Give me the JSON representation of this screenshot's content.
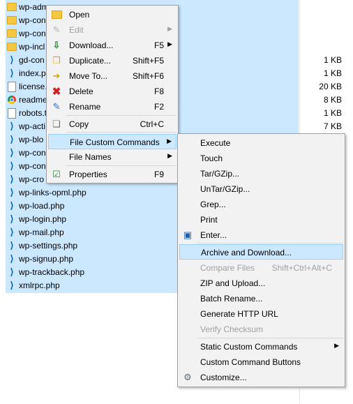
{
  "files": [
    {
      "name": "wp-adm",
      "icon": "folder-icon",
      "size": ""
    },
    {
      "name": "wp-con",
      "icon": "folder-icon",
      "size": ""
    },
    {
      "name": "wp-con",
      "icon": "folder-icon",
      "size": ""
    },
    {
      "name": "wp-incl",
      "icon": "folder-icon",
      "size": ""
    },
    {
      "name": "gd-con",
      "icon": "vscode-file-icon",
      "size": "1 KB"
    },
    {
      "name": "index.p",
      "icon": "vscode-file-icon",
      "size": "1 KB"
    },
    {
      "name": "license.",
      "icon": "text-file-icon",
      "size": "20 KB"
    },
    {
      "name": "readme",
      "icon": "chrome-file-icon",
      "size": "8 KB"
    },
    {
      "name": "robots.t",
      "icon": "text-file-icon",
      "size": "1 KB"
    },
    {
      "name": "wp-acti",
      "icon": "vscode-file-icon",
      "size": "7 KB"
    },
    {
      "name": "wp-blo",
      "icon": "vscode-file-icon",
      "size": ""
    },
    {
      "name": "wp-con",
      "icon": "vscode-file-icon",
      "size": ""
    },
    {
      "name": "wp-con",
      "icon": "vscode-file-icon",
      "size": ""
    },
    {
      "name": "wp-cro",
      "icon": "vscode-file-icon",
      "size": ""
    },
    {
      "name": "wp-links-opml.php",
      "icon": "vscode-file-icon",
      "size": ""
    },
    {
      "name": "wp-load.php",
      "icon": "vscode-file-icon",
      "size": ""
    },
    {
      "name": "wp-login.php",
      "icon": "vscode-file-icon",
      "size": ""
    },
    {
      "name": "wp-mail.php",
      "icon": "vscode-file-icon",
      "size": ""
    },
    {
      "name": "wp-settings.php",
      "icon": "vscode-file-icon",
      "size": ""
    },
    {
      "name": "wp-signup.php",
      "icon": "vscode-file-icon",
      "size": ""
    },
    {
      "name": "wp-trackback.php",
      "icon": "vscode-file-icon",
      "size": ""
    },
    {
      "name": "xmlrpc.php",
      "icon": "vscode-file-icon",
      "size": ""
    }
  ],
  "context_menu": {
    "items": [
      {
        "label": "Open",
        "shortcut": "",
        "icon": "open-folder-icon",
        "submenu": false,
        "disabled": false
      },
      {
        "label": "Edit",
        "shortcut": "",
        "icon": "edit-icon",
        "submenu": true,
        "disabled": true
      },
      {
        "label": "Download...",
        "shortcut": "F5",
        "icon": "download-icon",
        "submenu": true,
        "disabled": false
      },
      {
        "label": "Duplicate...",
        "shortcut": "Shift+F5",
        "icon": "duplicate-icon",
        "submenu": false,
        "disabled": false
      },
      {
        "label": "Move To...",
        "shortcut": "Shift+F6",
        "icon": "move-icon",
        "submenu": false,
        "disabled": false
      },
      {
        "label": "Delete",
        "shortcut": "F8",
        "icon": "delete-icon",
        "submenu": false,
        "disabled": false
      },
      {
        "label": "Rename",
        "shortcut": "F2",
        "icon": "rename-icon",
        "submenu": false,
        "disabled": false
      },
      {
        "label": "Copy",
        "shortcut": "Ctrl+C",
        "icon": "copy-icon",
        "submenu": false,
        "disabled": false
      },
      {
        "label": "File Custom Commands",
        "shortcut": "",
        "icon": "",
        "submenu": true,
        "disabled": false,
        "highlighted": true
      },
      {
        "label": "File Names",
        "shortcut": "",
        "icon": "",
        "submenu": true,
        "disabled": false
      },
      {
        "label": "Properties",
        "shortcut": "F9",
        "icon": "properties-icon",
        "submenu": false,
        "disabled": false
      }
    ]
  },
  "submenu": {
    "items": [
      {
        "label": "Execute",
        "shortcut": "",
        "icon": "",
        "disabled": false
      },
      {
        "label": "Touch",
        "shortcut": "",
        "icon": "",
        "disabled": false
      },
      {
        "label": "Tar/GZip...",
        "shortcut": "",
        "icon": "",
        "disabled": false
      },
      {
        "label": "UnTar/GZip...",
        "shortcut": "",
        "icon": "",
        "disabled": false
      },
      {
        "label": "Grep...",
        "shortcut": "",
        "icon": "",
        "disabled": false
      },
      {
        "label": "Print",
        "shortcut": "",
        "icon": "",
        "disabled": false
      },
      {
        "label": "Enter...",
        "shortcut": "",
        "icon": "terminal-icon",
        "disabled": false
      },
      {
        "label": "Archive and Download...",
        "shortcut": "",
        "icon": "",
        "disabled": false,
        "highlighted": true
      },
      {
        "label": "Compare Files",
        "shortcut": "Shift+Ctrl+Alt+C",
        "icon": "",
        "disabled": true
      },
      {
        "label": "ZIP and Upload...",
        "shortcut": "",
        "icon": "",
        "disabled": false
      },
      {
        "label": "Batch Rename...",
        "shortcut": "",
        "icon": "",
        "disabled": false
      },
      {
        "label": "Generate HTTP URL",
        "shortcut": "",
        "icon": "",
        "disabled": false
      },
      {
        "label": "Verify Checksum",
        "shortcut": "",
        "icon": "",
        "disabled": true
      },
      {
        "label": "Static Custom Commands",
        "shortcut": "",
        "icon": "",
        "disabled": false,
        "submenu": true
      },
      {
        "label": "Custom Command Buttons",
        "shortcut": "",
        "icon": "",
        "disabled": false
      },
      {
        "label": "Customize...",
        "shortcut": "",
        "icon": "gear-icon",
        "disabled": false
      }
    ]
  },
  "colors": {
    "selection": "#cce8ff",
    "menu_bg": "#f2f2f2",
    "highlight": "#cce8ff",
    "disabled_text": "#a0a0a0"
  }
}
